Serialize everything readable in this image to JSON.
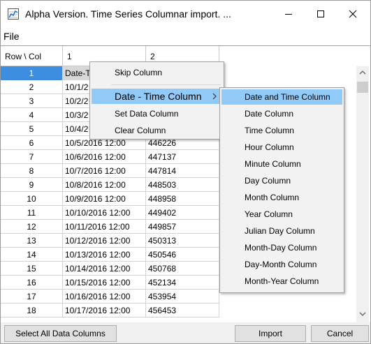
{
  "window": {
    "title": "Alpha Version.  Time Series Columnar import.  ..."
  },
  "menubar": {
    "file": "File"
  },
  "table": {
    "headers": [
      "Row \\ Col",
      "1",
      "2"
    ],
    "rows": [
      {
        "n": "1",
        "c1": "Date-T",
        "c2": ""
      },
      {
        "n": "2",
        "c1": "10/1/2",
        "c2": ""
      },
      {
        "n": "3",
        "c1": "10/2/2",
        "c2": ""
      },
      {
        "n": "4",
        "c1": "10/3/2",
        "c2": ""
      },
      {
        "n": "5",
        "c1": "10/4/2",
        "c2": ""
      },
      {
        "n": "6",
        "c1": "10/5/2016 12:00",
        "c2": "446226"
      },
      {
        "n": "7",
        "c1": "10/6/2016 12:00",
        "c2": "447137"
      },
      {
        "n": "8",
        "c1": "10/7/2016 12:00",
        "c2": "447814"
      },
      {
        "n": "9",
        "c1": "10/8/2016 12:00",
        "c2": "448503"
      },
      {
        "n": "10",
        "c1": "10/9/2016 12:00",
        "c2": "448958"
      },
      {
        "n": "11",
        "c1": "10/10/2016 12:00",
        "c2": "449402"
      },
      {
        "n": "12",
        "c1": "10/11/2016 12:00",
        "c2": "449857"
      },
      {
        "n": "13",
        "c1": "10/12/2016 12:00",
        "c2": "450313"
      },
      {
        "n": "14",
        "c1": "10/13/2016 12:00",
        "c2": "450546"
      },
      {
        "n": "15",
        "c1": "10/14/2016 12:00",
        "c2": "450768"
      },
      {
        "n": "16",
        "c1": "10/15/2016 12:00",
        "c2": "452134"
      },
      {
        "n": "17",
        "c1": "10/16/2016 12:00",
        "c2": "453954"
      },
      {
        "n": "18",
        "c1": "10/17/2016 12:00",
        "c2": "456453"
      }
    ]
  },
  "context_menu": {
    "skip": "Skip Column",
    "date_time": "Date - Time Column",
    "set_data": "Set Data Column",
    "clear": "Clear Column"
  },
  "submenu": {
    "items": [
      "Date and Time Column",
      "Date Column",
      "Time Column",
      "Hour Column",
      "Minute Column",
      "Day Column",
      "Month Column",
      "Year Column",
      "Julian Day Column",
      "Month-Day Column",
      "Day-Month Column",
      "Month-Year Column"
    ]
  },
  "buttons": {
    "select_all": "Select All Data Columns",
    "import": "Import",
    "cancel": "Cancel"
  },
  "colors": {
    "selection": "#3d8ee0",
    "menu_highlight": "#91c9f7"
  }
}
